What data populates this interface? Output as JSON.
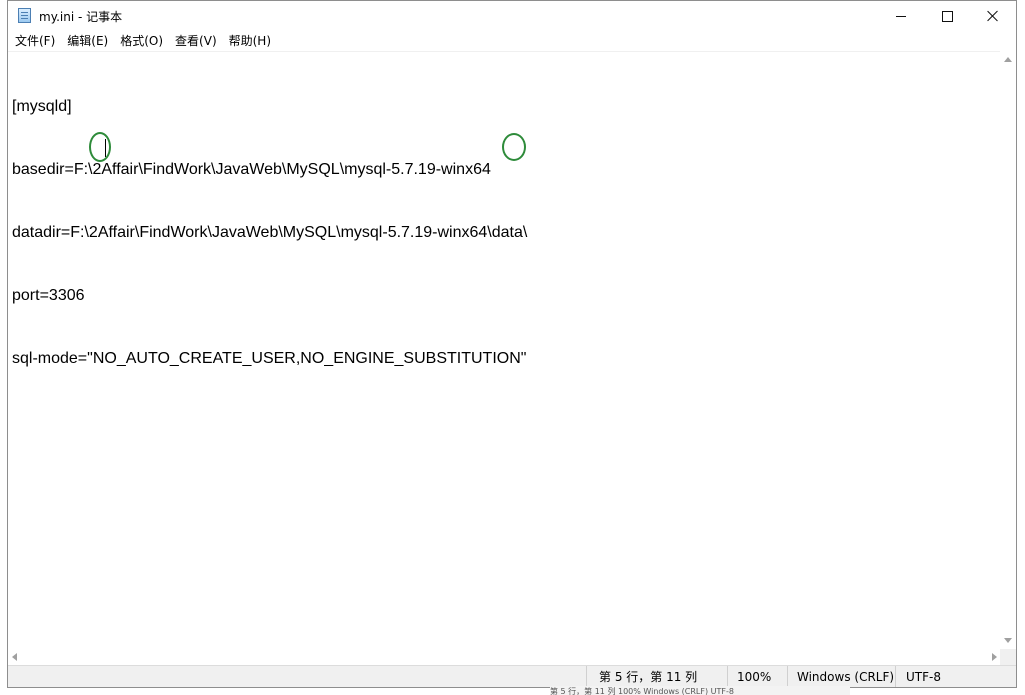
{
  "window": {
    "title": "my.ini - 记事本",
    "app_icon": "notepad-icon",
    "controls": {
      "minimize_icon": "minimize-icon",
      "maximize_icon": "maximize-icon",
      "close_icon": "close-icon"
    }
  },
  "menu": {
    "items": [
      "文件(F)",
      "编辑(E)",
      "格式(O)",
      "查看(V)",
      "帮助(H)"
    ]
  },
  "editor": {
    "lines": [
      "[mysqld]",
      "basedir=F:\\2Affair\\FindWork\\JavaWeb\\MySQL\\mysql-5.7.19-winx64",
      "datadir=F:\\2Affair\\FindWork\\JavaWeb\\MySQL\\mysql-5.7.19-winx64\\data\\",
      "port=3306",
      "sql-mode=\"NO_AUTO_CREATE_USER,NO_ENGINE_SUBSTITUTION\""
    ],
    "annotation_color": "#2e8b3a"
  },
  "statusbar": {
    "position": "第 5 行，第 11 列",
    "zoom": "100%",
    "line_ending": "Windows (CRLF)",
    "encoding": "UTF-8"
  },
  "background_strip": {
    "text": "第 5 行，第 11 列      100%     Windows (CRLF)     UTF-8"
  }
}
